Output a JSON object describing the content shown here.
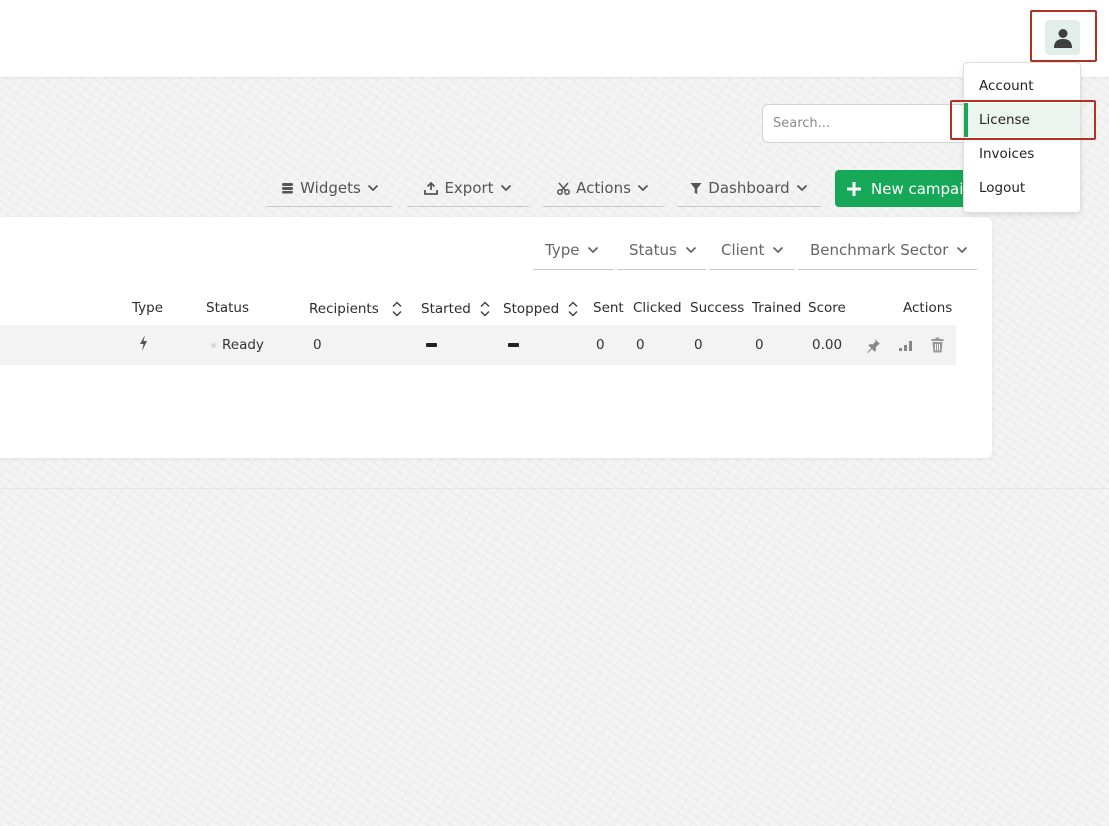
{
  "header": {
    "user_icon": "user-icon"
  },
  "search": {
    "placeholder": "Search..."
  },
  "toolbar": {
    "widgets": "Widgets",
    "export": "Export",
    "actions": "Actions",
    "dashboard": "Dashboard",
    "new_campaign": "New campaign"
  },
  "filters": {
    "type": "Type",
    "status": "Status",
    "client": "Client",
    "benchmark_sector": "Benchmark Sector"
  },
  "table": {
    "columns": {
      "type": "Type",
      "status": "Status",
      "recipients": "Recipients",
      "started": "Started",
      "stopped": "Stopped",
      "sent": "Sent",
      "clicked": "Clicked",
      "success": "Success",
      "trained": "Trained",
      "score": "Score",
      "actions": "Actions"
    },
    "rows": [
      {
        "type_icon": "lightning-icon",
        "status": "Ready",
        "recipients": "0",
        "started": "—",
        "stopped": "—",
        "sent": "0",
        "clicked": "0",
        "success": "0",
        "trained": "0",
        "score": "0.00"
      }
    ]
  },
  "user_menu": {
    "items": [
      {
        "label": "Account"
      },
      {
        "label": "License",
        "active": true
      },
      {
        "label": "Invoices"
      },
      {
        "label": "Logout"
      }
    ]
  },
  "colors": {
    "accent": "#16a857",
    "highlight": "#b0321f",
    "active_bg": "#ecf4ef"
  }
}
